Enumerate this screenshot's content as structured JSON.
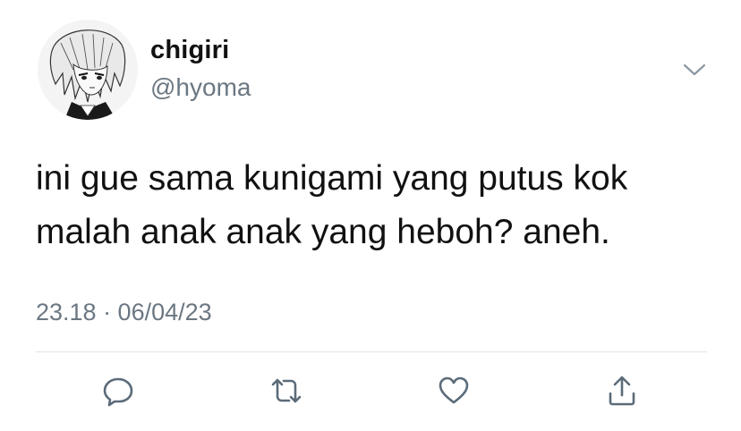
{
  "tweet": {
    "author": {
      "display_name": "chigiri",
      "handle": "@hyoma",
      "avatar": "anime-character-avatar-icon"
    },
    "text_lines": [
      "ini gue sama kunigami yang putus kok",
      "malah anak anak yang heboh? aneh."
    ],
    "timestamp": "23.18 · 06/04/23",
    "menu_icon": "chevron-down-icon",
    "actions": [
      {
        "name": "reply",
        "icon": "reply-icon"
      },
      {
        "name": "retweet",
        "icon": "retweet-icon"
      },
      {
        "name": "like",
        "icon": "heart-icon"
      },
      {
        "name": "share",
        "icon": "share-icon"
      }
    ]
  },
  "colors": {
    "text": "#111111",
    "secondary": "#6b7782",
    "divider": "#e1e5e8",
    "icon": "#5b6b79"
  }
}
